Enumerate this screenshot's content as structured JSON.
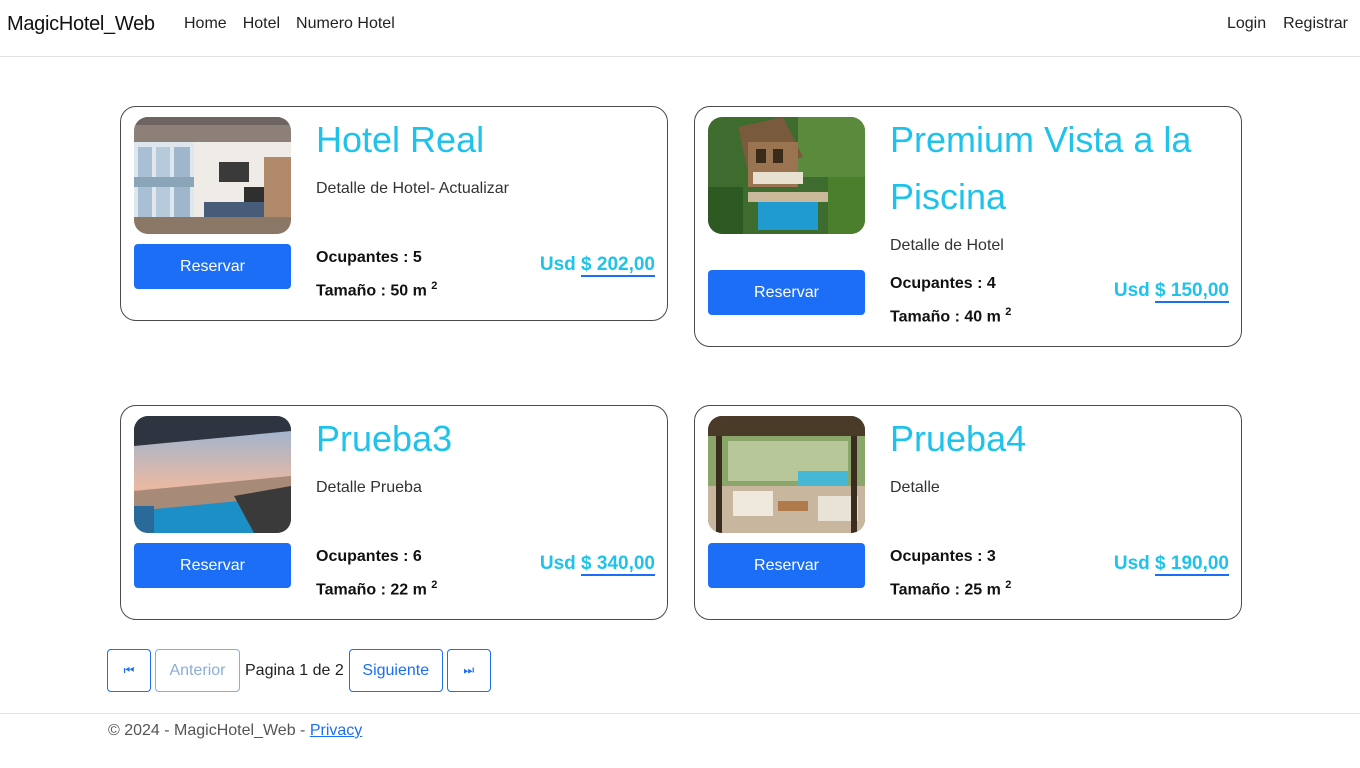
{
  "navbar": {
    "brand": "MagicHotel_Web",
    "links": [
      "Home",
      "Hotel",
      "Numero Hotel"
    ],
    "right_links": [
      "Login",
      "Registrar"
    ]
  },
  "cards": [
    {
      "name": "Hotel Real",
      "detail": "Detalle de Hotel- Actualizar",
      "button": "Reservar",
      "ocupantes": "Ocupantes : 5",
      "tamano": "Tamaño : 50 m",
      "sup": "2",
      "price_prefix": "Usd",
      "price": "$ 202,00"
    },
    {
      "name": "Premium Vista a la Piscina",
      "detail": "Detalle de Hotel",
      "button": "Reservar",
      "ocupantes": "Ocupantes : 4",
      "tamano": "Tamaño : 40 m",
      "sup": "2",
      "price_prefix": "Usd",
      "price": "$ 150,00"
    },
    {
      "name": "Prueba3",
      "detail": "Detalle Prueba",
      "button": "Reservar",
      "ocupantes": "Ocupantes : 6",
      "tamano": "Tamaño : 22 m",
      "sup": "2",
      "price_prefix": "Usd",
      "price": "$ 340,00"
    },
    {
      "name": "Prueba4",
      "detail": "Detalle",
      "button": "Reservar",
      "ocupantes": "Ocupantes : 3",
      "tamano": "Tamaño : 25 m",
      "sup": "2",
      "price_prefix": "Usd",
      "price": "$ 190,00"
    }
  ],
  "pagination": {
    "first_icon": "⏮",
    "prev_label": "Anterior",
    "page_text": "Pagina 1 de 2",
    "next_label": "Siguiente",
    "last_icon": "⏭"
  },
  "footer": {
    "text": "© 2024 - MagicHotel_Web - ",
    "privacy": "Privacy"
  },
  "colors": {
    "accent": "#1ec2ea",
    "primary": "#1b6ef5"
  }
}
